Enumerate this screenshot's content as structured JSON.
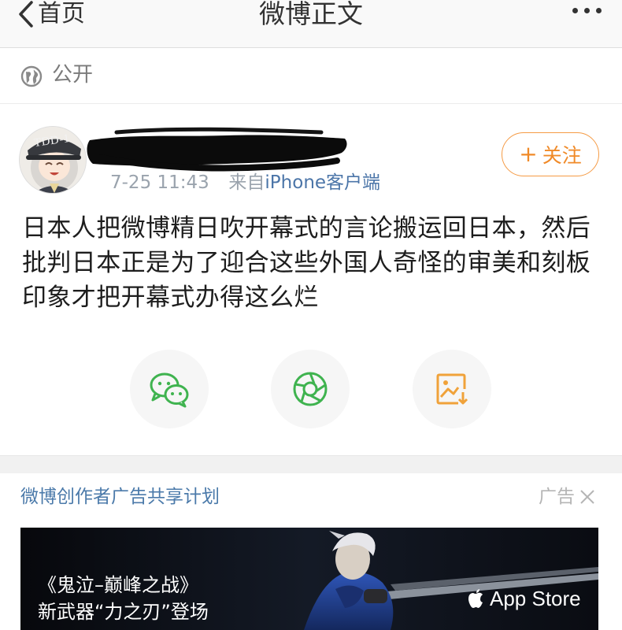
{
  "navbar": {
    "back_label": "首页",
    "title": "微博正文",
    "more_icon": "more-dots-icon"
  },
  "visibility": {
    "icon": "globe-icon",
    "label": "公开"
  },
  "post": {
    "author_name_redacted": true,
    "avatar_badge": "TDD-1",
    "time": "7-25 11:43",
    "source_prefix": "来自",
    "source": "iPhone客户端",
    "follow_label": "关注",
    "text": "日本人把微博精日吹开幕式的言论搬运回日本，然后批判日本正是为了迎合这些外国人奇怪的审美和刻板印象才把开幕式办得这么烂"
  },
  "share": [
    {
      "icon": "wechat-icon",
      "color": "#3fb34f"
    },
    {
      "icon": "moments-icon",
      "color": "#3fb34f"
    },
    {
      "icon": "save-image-icon",
      "color": "#f0a23a"
    }
  ],
  "ad": {
    "header": "微博创作者广告共享计划",
    "tag": "广告",
    "close_icon": "close-icon",
    "line1": "《鬼泣–巅峰之战》",
    "line2": "新武器“力之刃”登场",
    "store_label": "App Store",
    "store_icon": "apple-icon"
  },
  "colors": {
    "accent": "#f08a28",
    "link": "#4b75a8",
    "green": "#3fb34f"
  }
}
